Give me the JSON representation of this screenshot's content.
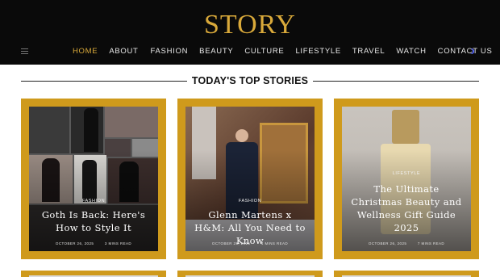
{
  "site": {
    "logo": "STORY"
  },
  "nav": {
    "items": [
      "HOME",
      "ABOUT",
      "FASHION",
      "BEAUTY",
      "CULTURE",
      "LIFESTYLE",
      "TRAVEL",
      "WATCH",
      "CONTACT US"
    ],
    "active": "HOME"
  },
  "section": {
    "title": "TODAY'S TOP STORIES"
  },
  "cards": [
    {
      "category": "FASHION",
      "title": "Goth Is Back: Here's How to Style It",
      "date": "OCTOBER 26, 2025",
      "read": "3 MINS READ"
    },
    {
      "category": "FASHION",
      "title": "Glenn Martens x H&M: All You Need to Know",
      "date": "OCTOBER 25, 2025",
      "read": "4 MINS READ"
    },
    {
      "category": "LIFESTYLE",
      "title": "The Ultimate Christmas Beauty and Wellness Gift Guide 2025",
      "date": "OCTOBER 26, 2025",
      "read": "7 MINS READ"
    }
  ],
  "colors": {
    "accent": "#d9a93a",
    "card_frame": "#cf9a1c",
    "header_bg": "#0a0a0a",
    "dark_mode_toggle": "#5b6cff"
  },
  "icons": {
    "menu": "hamburger-menu-icon",
    "theme": "moon-icon"
  }
}
